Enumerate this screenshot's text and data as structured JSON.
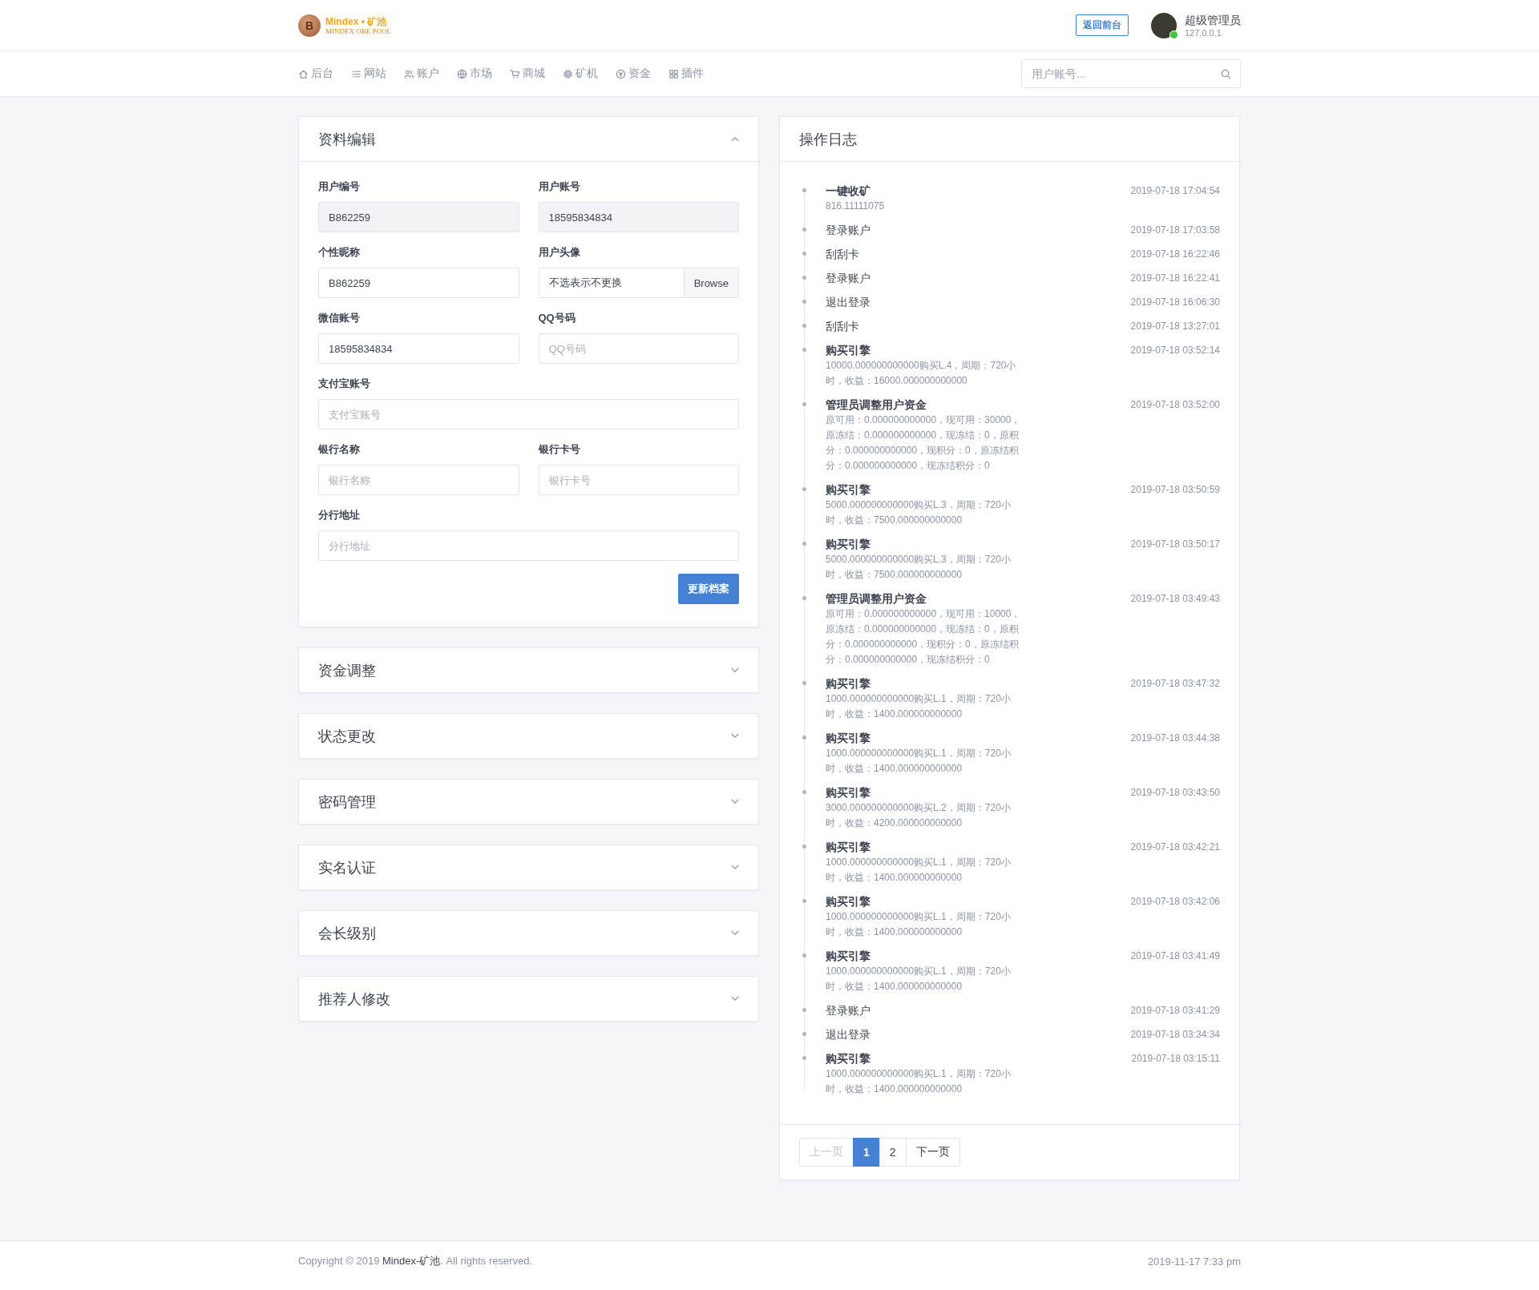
{
  "header": {
    "logo_title": "Mindex • 矿池",
    "logo_subtitle": "MINDEX ORE POOL",
    "logo_glyph": "B",
    "front_button": "返回前台",
    "user": {
      "name": "超级管理员",
      "ip": "127.0.0.1",
      "online": true
    }
  },
  "nav": {
    "items": [
      {
        "label": "后台"
      },
      {
        "label": "网站"
      },
      {
        "label": "账户"
      },
      {
        "label": "市场"
      },
      {
        "label": "商城"
      },
      {
        "label": "矿机"
      },
      {
        "label": "资金"
      },
      {
        "label": "插件"
      }
    ],
    "search": {
      "placeholder": "用户账号..."
    }
  },
  "sections": [
    {
      "title": "资料编辑",
      "expanded": true,
      "form": {
        "rows": [
          [
            {
              "label": "用户编号",
              "kind": "text",
              "value": "B862259",
              "disabled": true
            },
            {
              "label": "用户账号",
              "kind": "text",
              "value": "18595834834",
              "disabled": true
            }
          ],
          [
            {
              "label": "个性昵称",
              "kind": "text",
              "value": "B862259",
              "disabled": false
            },
            {
              "label": "用户头像",
              "kind": "file",
              "value": "不选表示不更换",
              "button": "Browse"
            }
          ],
          [
            {
              "label": "微信账号",
              "kind": "text",
              "value": "18595834834",
              "disabled": false
            },
            {
              "label": "QQ号码",
              "kind": "text",
              "placeholder": "QQ号码",
              "disabled": false
            }
          ],
          [
            {
              "label": "支付宝账号",
              "kind": "text",
              "placeholder": "支付宝账号",
              "disabled": false
            }
          ],
          [
            {
              "label": "银行名称",
              "kind": "text",
              "placeholder": "银行名称",
              "disabled": false
            },
            {
              "label": "银行卡号",
              "kind": "text",
              "placeholder": "银行卡号",
              "disabled": false
            }
          ],
          [
            {
              "label": "分行地址",
              "kind": "text",
              "placeholder": "分行地址",
              "disabled": false
            }
          ]
        ],
        "submit": "更新档案"
      }
    },
    {
      "title": "资金调整",
      "expanded": false
    },
    {
      "title": "状态更改",
      "expanded": false
    },
    {
      "title": "密码管理",
      "expanded": false
    },
    {
      "title": "实名认证",
      "expanded": false
    },
    {
      "title": "会长级别",
      "expanded": false
    },
    {
      "title": "推荐人修改",
      "expanded": false
    }
  ],
  "log": {
    "title": "操作日志",
    "entries": [
      {
        "title": "一键收矿",
        "detail": "816.11111075",
        "time": "2019-07-18 17:04:54"
      },
      {
        "title": "登录账户",
        "time": "2019-07-18 17:03:58"
      },
      {
        "title": "刮刮卡",
        "time": "2019-07-18 16:22:46"
      },
      {
        "title": "登录账户",
        "time": "2019-07-18 16:22:41"
      },
      {
        "title": "退出登录",
        "time": "2019-07-18 16:06:30"
      },
      {
        "title": "刮刮卡",
        "time": "2019-07-18 13:27:01"
      },
      {
        "title": "购买引擎",
        "detail": "10000.000000000000购买L.4，周期：720小时，收益：16000.000000000000",
        "time": "2019-07-18 03:52:14"
      },
      {
        "title": "管理员调整用户资金",
        "detail": "原可用：0.000000000000，现可用：30000，原冻结：0.000000000000，现冻结：0，原积分：0.000000000000，现积分：0，原冻结积分：0.000000000000，现冻结积分：0",
        "time": "2019-07-18 03:52:00"
      },
      {
        "title": "购买引擎",
        "detail": "5000.000000000000购买L.3，周期：720小时，收益：7500.000000000000",
        "time": "2019-07-18 03:50:59"
      },
      {
        "title": "购买引擎",
        "detail": "5000.000000000000购买L.3，周期：720小时，收益：7500.000000000000",
        "time": "2019-07-18 03:50:17"
      },
      {
        "title": "管理员调整用户资金",
        "detail": "原可用：0.000000000000，现可用：10000，原冻结：0.000000000000，现冻结：0，原积分：0.000000000000，现积分：0，原冻结积分：0.000000000000，现冻结积分：0",
        "time": "2019-07-18 03:49:43"
      },
      {
        "title": "购买引擎",
        "detail": "1000.000000000000购买L.1，周期：720小时，收益：1400.000000000000",
        "time": "2019-07-18 03:47:32"
      },
      {
        "title": "购买引擎",
        "detail": "1000.000000000000购买L.1，周期：720小时，收益：1400.000000000000",
        "time": "2019-07-18 03:44:38"
      },
      {
        "title": "购买引擎",
        "detail": "3000.000000000000购买L.2，周期：720小时，收益：4200.000000000000",
        "time": "2019-07-18 03:43:50"
      },
      {
        "title": "购买引擎",
        "detail": "1000.000000000000购买L.1，周期：720小时，收益：1400.000000000000",
        "time": "2019-07-18 03:42:21"
      },
      {
        "title": "购买引擎",
        "detail": "1000.000000000000购买L.1，周期：720小时，收益：1400.000000000000",
        "time": "2019-07-18 03:42:06"
      },
      {
        "title": "购买引擎",
        "detail": "1000.000000000000购买L.1，周期：720小时，收益：1400.000000000000",
        "time": "2019-07-18 03:41:49"
      },
      {
        "title": "登录账户",
        "time": "2019-07-18 03:41:29"
      },
      {
        "title": "退出登录",
        "time": "2019-07-18 03:34:34"
      },
      {
        "title": "购买引擎",
        "detail": "1000.000000000000购买L.1，周期：720小时，收益：1400.000000000000",
        "time": "2019-07-18 03:15:11"
      }
    ],
    "pagination": [
      {
        "label": "上一页",
        "selected": false,
        "disabled": true
      },
      {
        "label": "1",
        "selected": true,
        "disabled": false
      },
      {
        "label": "2",
        "selected": false,
        "disabled": false
      },
      {
        "label": "下一页",
        "selected": false,
        "disabled": false
      }
    ]
  },
  "footer": {
    "copyright_before": "Copyright © 2019 ",
    "brand_link": "Mindex-矿池",
    "copyright_after": ". All rights reserved.",
    "timestamp": "2019-11-17 7:33 pm"
  }
}
